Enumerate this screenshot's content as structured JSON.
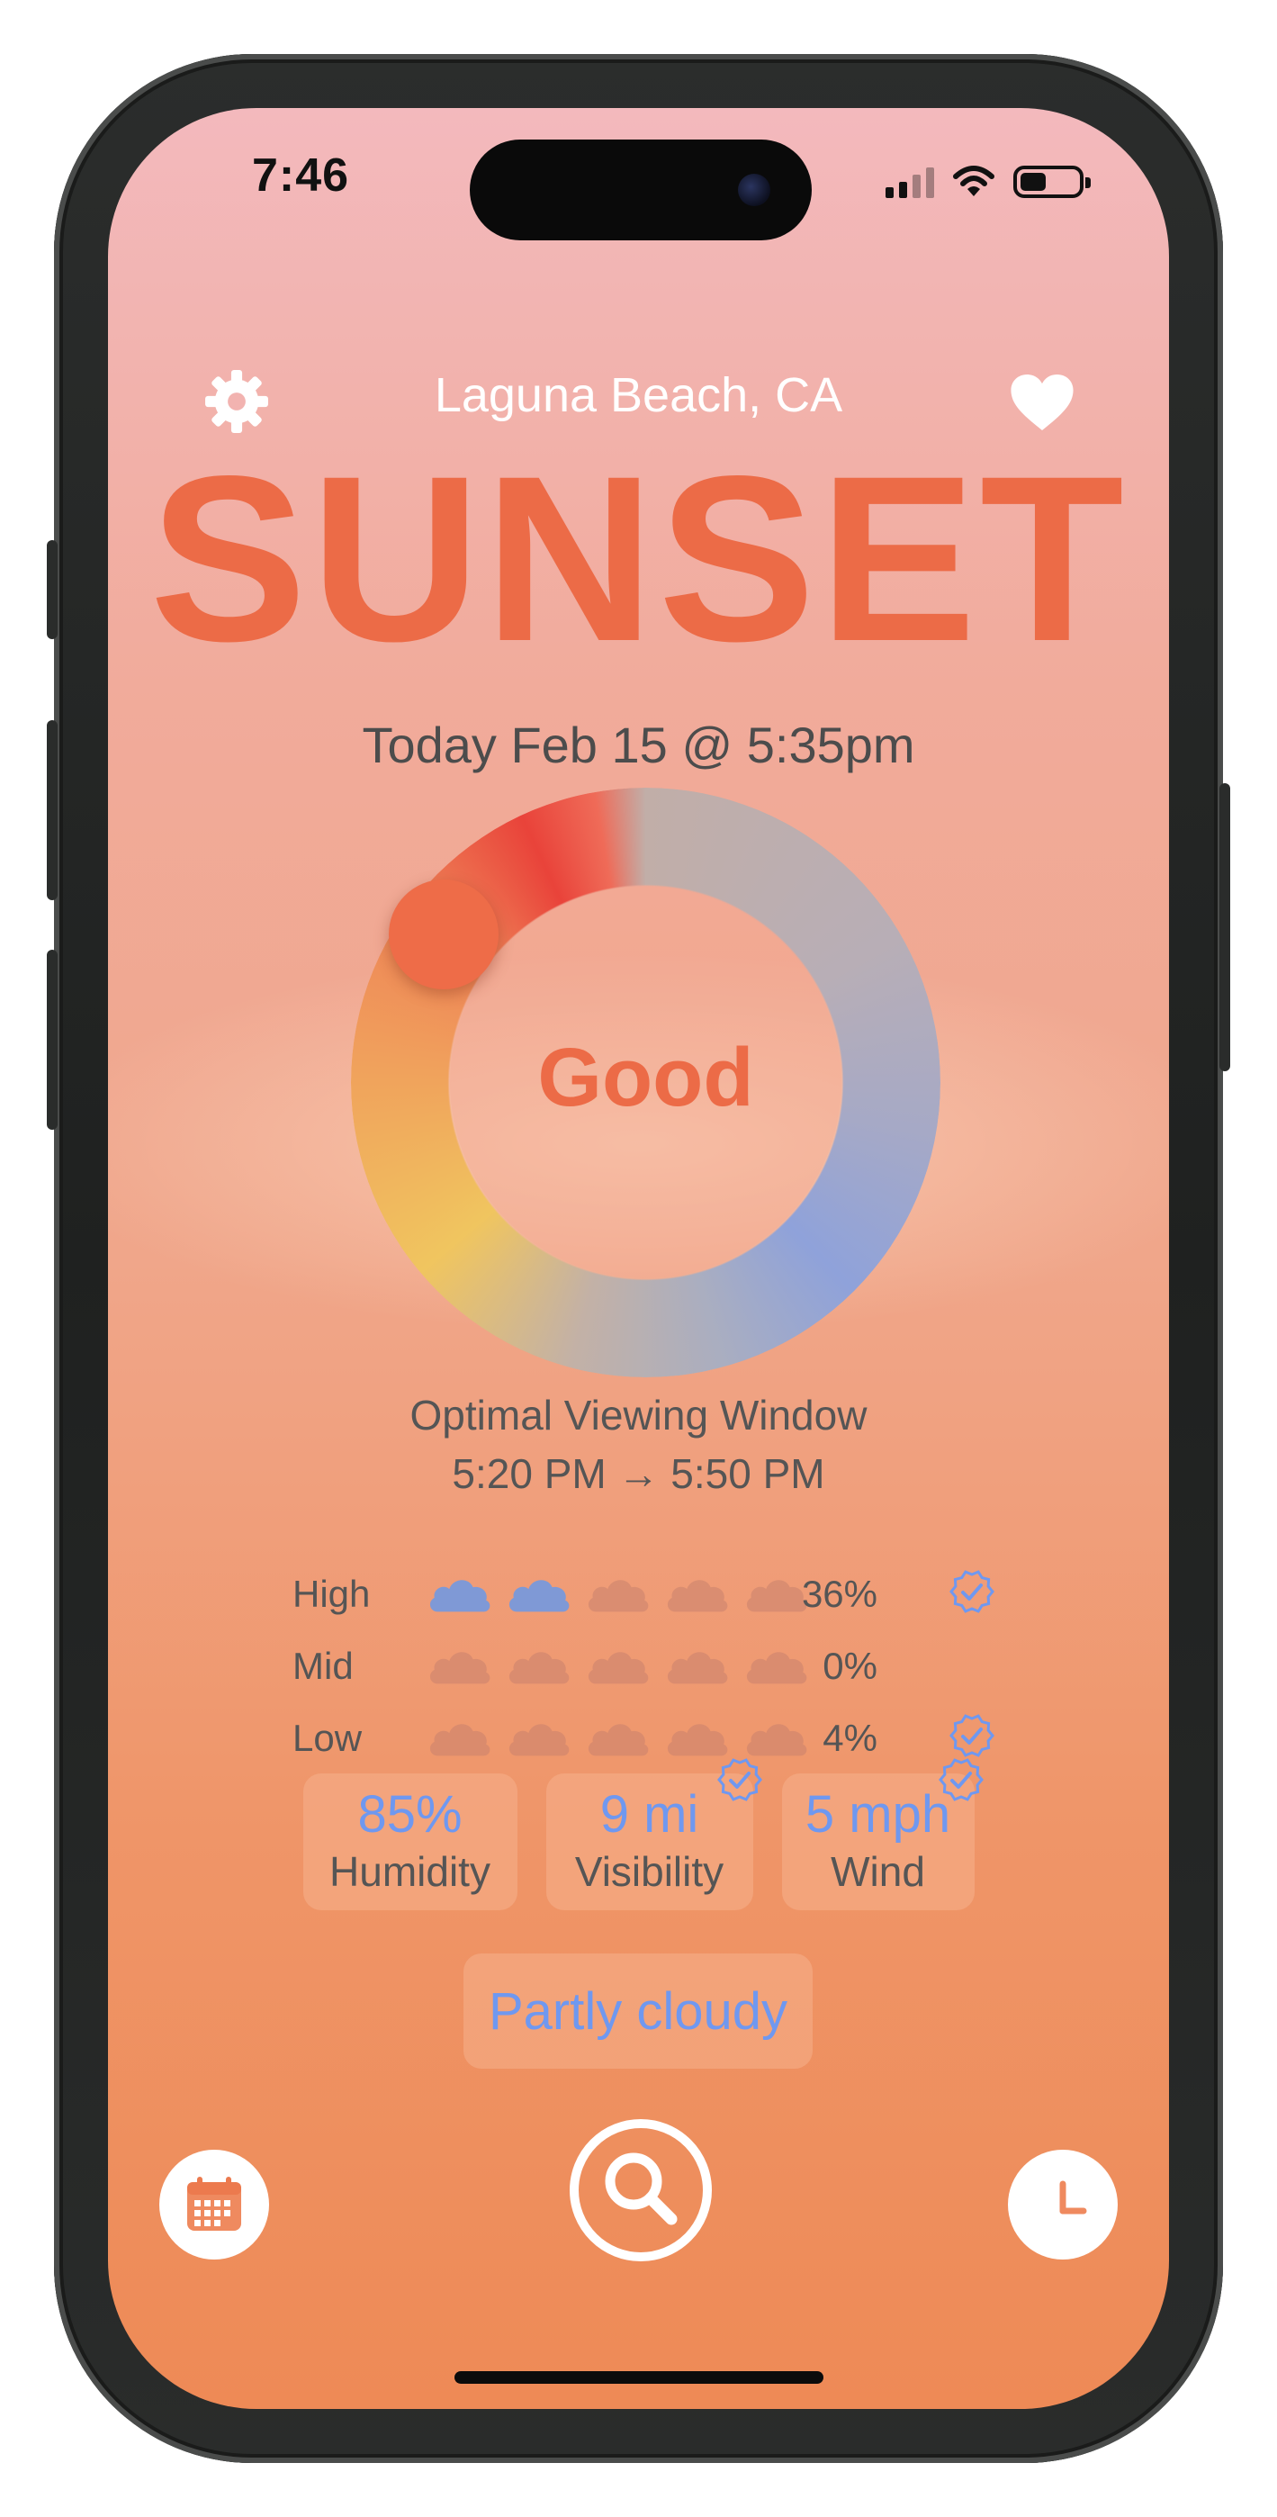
{
  "status_bar": {
    "time": "7:46",
    "icons": [
      "cellular-signal-icon",
      "wifi-icon",
      "battery-icon"
    ]
  },
  "header": {
    "location": "Laguna Beach, CA",
    "left_icon": "gear-icon",
    "right_icon": "heart-icon"
  },
  "event": {
    "title": "SUNSET",
    "date": "Today Feb 15 @ 5:35pm"
  },
  "quality": {
    "label": "Good"
  },
  "viewing_window": {
    "label": "Optimal Viewing Window",
    "time": "5:20 PM → 5:50 PM"
  },
  "cloud_cover": {
    "rows": [
      {
        "label": "High",
        "percent": "36%",
        "filled": 2,
        "total": 5,
        "verified": true
      },
      {
        "label": "Mid",
        "percent": "0%",
        "filled": 0,
        "total": 5,
        "verified": false
      },
      {
        "label": "Low",
        "percent": "4%",
        "filled": 0,
        "total": 5,
        "verified": true
      }
    ]
  },
  "metrics": [
    {
      "value": "85%",
      "label": "Humidity",
      "verified": false
    },
    {
      "value": "9 mi",
      "label": "Visibility",
      "verified": true
    },
    {
      "value": "5 mph",
      "label": "Wind",
      "verified": true
    }
  ],
  "condition": "Partly cloudy",
  "bottom_nav": {
    "left_icon": "calendar-icon",
    "center_icon": "search-icon",
    "right_icon": "clock-icon"
  },
  "colors": {
    "accent": "#ec6b47",
    "info_blue": "#6f98f0",
    "text_gray": "#555555"
  }
}
